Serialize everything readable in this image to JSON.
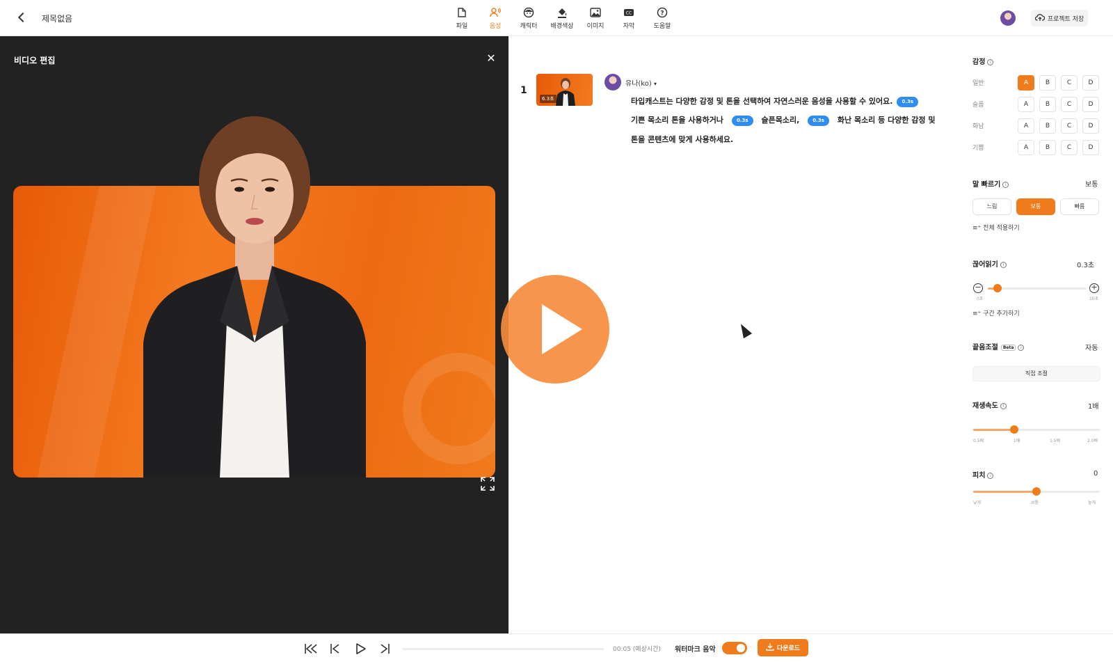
{
  "header": {
    "title": "제목없음",
    "tools": [
      {
        "label": "파일",
        "icon": "file-icon",
        "active": false
      },
      {
        "label": "음성",
        "icon": "voice-icon",
        "active": true
      },
      {
        "label": "캐릭터",
        "icon": "character-icon",
        "active": false
      },
      {
        "label": "배경색상",
        "icon": "paint-bucket-icon",
        "active": false
      },
      {
        "label": "이미지",
        "icon": "image-icon",
        "active": false
      },
      {
        "label": "자막",
        "icon": "caption-icon",
        "active": false
      },
      {
        "label": "도움말",
        "icon": "help-icon",
        "active": false
      }
    ],
    "save_label": "프로젝트 저장",
    "accent": "#f07b1b"
  },
  "video_panel": {
    "title": "비디오 편집",
    "close_symbol": "✕"
  },
  "scene": {
    "number": "1",
    "duration": "6.3초",
    "voice_name": "유나(ko)",
    "script": {
      "line1": "타입캐스트는 다양한 감정 및 톤을 선택하여 자연스러운 음성을 사용할 수 있어요.",
      "line2_a": "기쁜 목소리 톤을 사용하거나",
      "line2_b": "슬픈목소리,",
      "line2_c": "화난 목소리 등 다양한 감정 및",
      "line3": "톤을 콘텐츠에 맞게 사용하세요.",
      "pause": "0.3s"
    }
  },
  "settings": {
    "emotion": {
      "label": "감정",
      "rows": [
        {
          "label": "일반",
          "selected": "A"
        },
        {
          "label": "슬픔",
          "selected": ""
        },
        {
          "label": "화남",
          "selected": ""
        },
        {
          "label": "기쁨",
          "selected": ""
        }
      ],
      "options": [
        "A",
        "B",
        "C",
        "D"
      ]
    },
    "speed": {
      "label": "말 빠르기",
      "value": "보통",
      "options": [
        "느림",
        "보통",
        "빠름"
      ],
      "selected": "보통",
      "apply_all": "전체 적용하기"
    },
    "pause": {
      "label": "끊어읽기",
      "value": "0.3초",
      "min": "0초",
      "max": "10초",
      "level": 0.3,
      "add_section": "구간 추가하기"
    },
    "trim": {
      "label": "끝음조절",
      "badge": "Beta",
      "value": "자동",
      "button": "직접 조절"
    },
    "playback": {
      "label": "재생속도",
      "value": "1배",
      "ticks": [
        "0.5배",
        "1배",
        "1.5배",
        "2.0배"
      ],
      "level": 1.0
    },
    "pitch": {
      "label": "피치",
      "value": "0",
      "ticks": [
        "낮게",
        "보통",
        "높게"
      ],
      "level": 0
    }
  },
  "player": {
    "time": "00:05 (예상시간)",
    "watermark_music_label": "워터마크 음악",
    "watermark_music_on": true,
    "download_label": "다운로드"
  }
}
